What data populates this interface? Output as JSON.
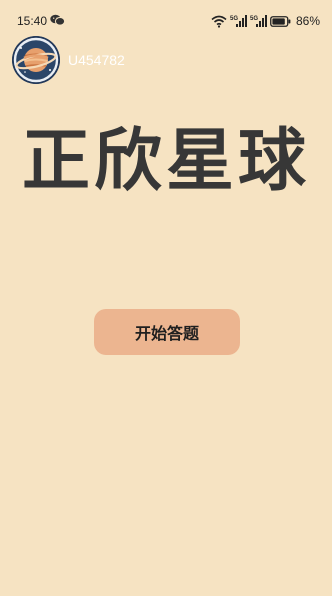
{
  "status_bar": {
    "time": "15:40",
    "battery": "86%",
    "network_label": "5G"
  },
  "user": {
    "username": "U454782"
  },
  "app": {
    "title": "正欣星球"
  },
  "main": {
    "start_button_label": "开始答题"
  }
}
